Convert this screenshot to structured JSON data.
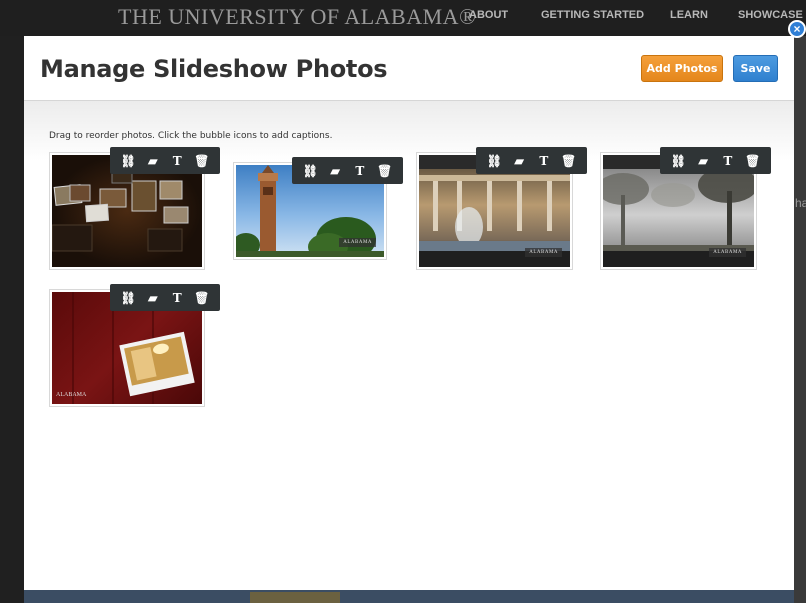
{
  "background": {
    "site_title": "THE UNIVERSITY OF ALABAMA®",
    "nav": [
      "ABOUT",
      "GETTING STARTED",
      "LEARN",
      "SHOWCASE"
    ],
    "peek_text": "ha"
  },
  "modal": {
    "title": "Manage Slideshow Photos",
    "add_photos_label": "Add Photos",
    "save_label": "Save",
    "close_glyph": "×",
    "instructions": "Drag to reorder photos. Click the bubble icons to add captions."
  },
  "toolbar_icons": [
    "link-icon",
    "caption-bubble-icon",
    "title-text-icon",
    "trash-icon"
  ],
  "photos": [
    {
      "subject": "collage of framed photos on dark background"
    },
    {
      "subject": "bell tower against blue sky",
      "watermark": "ALABAMA"
    },
    {
      "subject": "columned building with fountain",
      "watermark": "ALABAMA"
    },
    {
      "subject": "misty trees",
      "watermark": "ALABAMA"
    },
    {
      "subject": "red background with framed room photo",
      "watermark": "ALABAMA"
    }
  ],
  "colors": {
    "add_button": "#e88e22",
    "save_button": "#3a8bd8",
    "toolbar": "#2f3436",
    "close_button": "#2f7fd6"
  }
}
